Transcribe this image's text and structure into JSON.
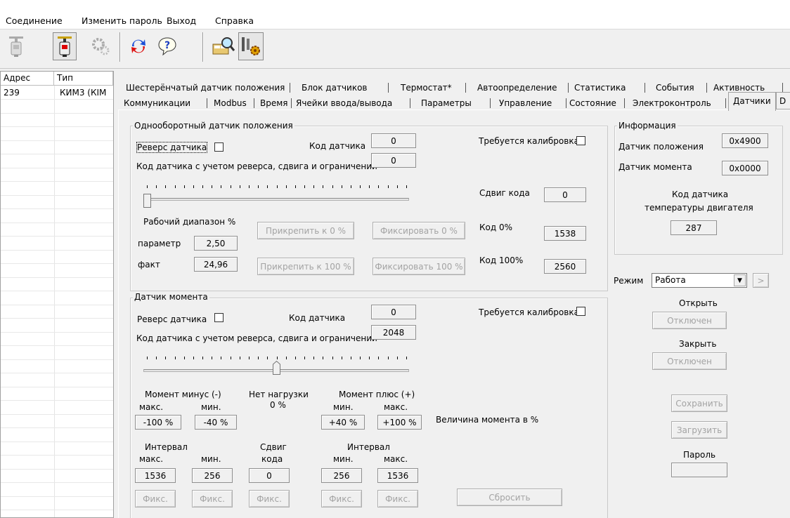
{
  "menu": [
    "Соединение",
    "Изменить пароль",
    "Выход",
    "Справка"
  ],
  "toolbar": {
    "icons": [
      "connect-device-icon",
      "disconnect-device-icon",
      "gear-icon",
      "refresh-icon",
      "help-icon",
      "search-icon",
      "tools-icon"
    ]
  },
  "device_list": {
    "columns": [
      "Адрес",
      "Тип"
    ],
    "rows": [
      {
        "address": "239",
        "type": "КИМ3 (КІМ"
      }
    ]
  },
  "tabs": {
    "row1": [
      "Шестерёнчатый датчик положения",
      "Блок датчиков",
      "Термостат*",
      "Автоопределение",
      "Статистика",
      "События",
      "Активность"
    ],
    "row2": [
      "Коммуникации",
      "Modbus",
      "Время",
      "Ячейки ввода/вывода",
      "Параметры",
      "Управление",
      "Состояние",
      "Электроконтроль",
      "Датчики"
    ],
    "active": "Датчики",
    "overflow": "D"
  },
  "position_sensor": {
    "title": "Однооборотный датчик положения",
    "reverse_label": "Реверс датчика",
    "code_label": "Код датчика",
    "code": "0",
    "calib_label": "Требуется калибровка",
    "adj_code_label": "Код датчика с учетом реверса, сдвига и ограничений",
    "adj_code": "0",
    "shift_label": "Сдвиг кода",
    "shift": "0",
    "slider_position": 0,
    "range_label": "Рабочий диапазон %",
    "param_label": "параметр",
    "param": "2,50",
    "fact_label": "факт",
    "fact": "24,96",
    "attach0": "Прикрепить к  0 %",
    "attach100": "Прикрепить к 100 %",
    "fix0": "Фиксировать  0 %",
    "fix100": "Фиксировать 100 %",
    "code0_label": "Код 0%",
    "code0": "1538",
    "code100_label": "Код 100%",
    "code100": "2560"
  },
  "info": {
    "title": "Информация",
    "pos_label": "Датчик положения",
    "pos": "0x4900",
    "torque_label": "Датчик момента",
    "torque": "0x0000",
    "temp_label1": "Код датчика",
    "temp_label2": "температуры двигателя",
    "temp": "287"
  },
  "mode": {
    "label": "Режим",
    "value": "Работа",
    "next": ">"
  },
  "control": {
    "open_label": "Открыть",
    "open_btn": "Отключен",
    "close_label": "Закрыть",
    "close_btn": "Отключен",
    "save": "Сохранить",
    "load": "Загрузить",
    "password_label": "Пароль",
    "password": ""
  },
  "torque_sensor": {
    "title": "Датчик момента",
    "reverse_label": "Реверс датчика",
    "code_label": "Код датчика",
    "code": "0",
    "calib_label": "Требуется калибровка",
    "adj_code_label": "Код датчика с учетом реверса, сдвига и ограничений",
    "adj_code": "2048",
    "slider_position": 0.5,
    "minus_label": "Момент минус (-)",
    "noload_label": "Нет нагрузки",
    "plus_label": "Момент плюс (+)",
    "max_label": "макс.",
    "min_label": "мин.",
    "zero_pct": "0 %",
    "minus_max": "-100 %",
    "minus_min": "-40 %",
    "plus_min": "+40 %",
    "plus_max": "+100 %",
    "magnitude_label": "Величина момента в %",
    "interval_label": "Интервал",
    "shift_label1": "Сдвиг",
    "shift_label2": "кода",
    "int_l_max": "1536",
    "int_l_min": "256",
    "shift": "0",
    "int_r_min": "256",
    "int_r_max": "1536",
    "fix": "Фикс.",
    "reset": "Сбросить"
  }
}
